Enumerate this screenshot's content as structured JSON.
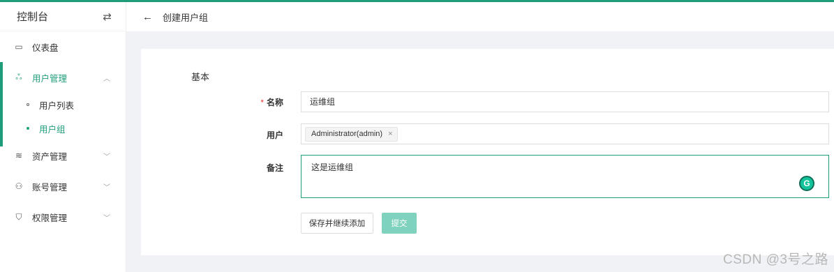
{
  "sidebar": {
    "title": "控制台",
    "items": [
      {
        "label": "仪表盘",
        "icon": "dashboard-icon"
      },
      {
        "label": "用户管理",
        "icon": "users-icon",
        "expanded": true,
        "children": [
          {
            "label": "用户列表"
          },
          {
            "label": "用户组",
            "active": true
          }
        ]
      },
      {
        "label": "资产管理",
        "icon": "assets-icon"
      },
      {
        "label": "账号管理",
        "icon": "accounts-icon"
      },
      {
        "label": "权限管理",
        "icon": "shield-icon"
      }
    ]
  },
  "header": {
    "title": "创建用户组"
  },
  "form": {
    "section": "基本",
    "name_label": "名称",
    "name_value": "运维组",
    "user_label": "用户",
    "user_tag": "Administrator(admin)",
    "remark_label": "备注",
    "remark_value": "这是运维组",
    "save_label": "保存并继续添加",
    "submit_label": "提交"
  },
  "colors": {
    "accent": "#1f9d7a",
    "submit": "#7fd2bd"
  },
  "watermark": "CSDN @3号之路"
}
